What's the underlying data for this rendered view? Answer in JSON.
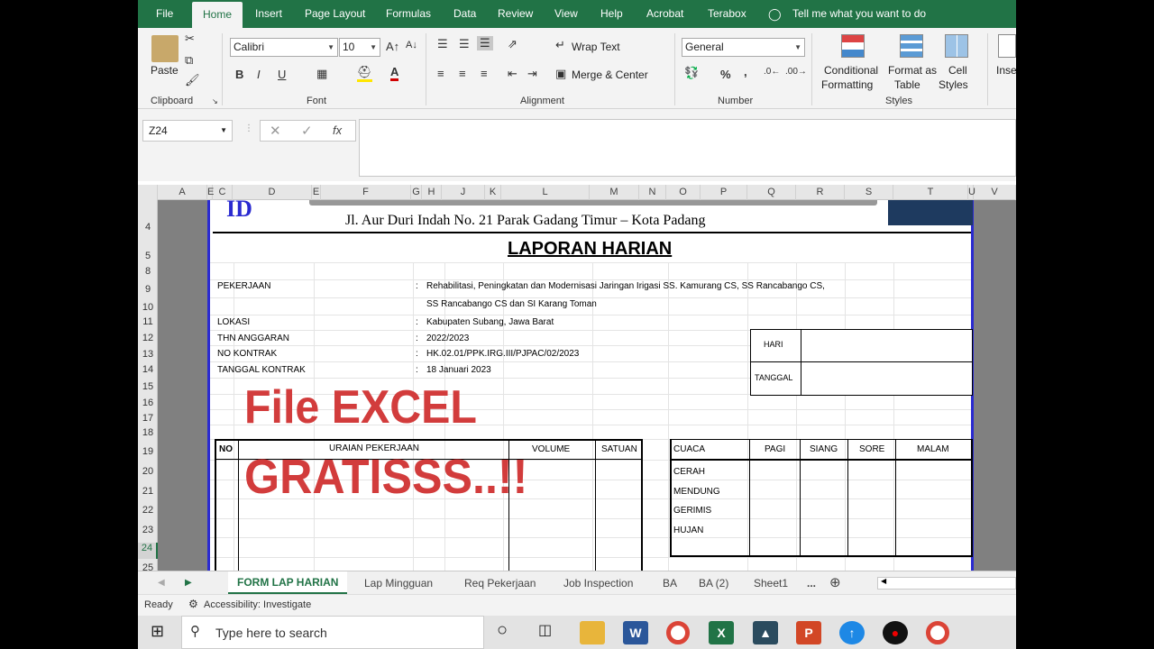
{
  "ribbon_tabs": [
    "File",
    "Home",
    "Insert",
    "Page Layout",
    "Formulas",
    "Data",
    "Review",
    "View",
    "Help",
    "Acrobat",
    "Terabox"
  ],
  "tell_me": "Tell me what you want to do",
  "clipboard": {
    "paste": "Paste",
    "label": "Clipboard"
  },
  "font": {
    "name": "Calibri",
    "size": "10",
    "label": "Font",
    "bold": "B",
    "italic": "I",
    "underline": "U"
  },
  "alignment": {
    "wrap": "Wrap Text",
    "merge": "Merge & Center",
    "label": "Alignment"
  },
  "number": {
    "format": "General",
    "label": "Number",
    "percent": "%",
    "comma": ","
  },
  "styles": {
    "conditional_1": "Conditional",
    "conditional_2": "Formatting",
    "format_1": "Format as",
    "format_2": "Table",
    "cell_1": "Cell",
    "cell_2": "Styles",
    "label": "Styles"
  },
  "insert_cut": "Inse",
  "formula_bar": {
    "name_box": "Z24",
    "fx": "fx",
    "value": ""
  },
  "columns": [
    "A",
    "E",
    "C",
    "D",
    "E",
    "F",
    "G",
    "H",
    "J",
    "K",
    "L",
    "M",
    "N",
    "O",
    "P",
    "Q",
    "R",
    "S",
    "T",
    "U",
    "V"
  ],
  "rows": [
    "4",
    "5",
    "8",
    "9",
    "10",
    "11",
    "12",
    "13",
    "14",
    "15",
    "16",
    "17",
    "18",
    "19",
    "20",
    "21",
    "22",
    "23",
    "24",
    "25"
  ],
  "doc": {
    "address": "Jl. Aur Duri Indah No. 21 Parak Gadang Timur – Kota Padang",
    "title": "LAPORAN HARIAN",
    "pekerjaan_label": "PEKERJAAN",
    "pekerjaan_1": "Rehabilitasi, Peningkatan dan Modernisasi Jaringan Irigasi SS. Kamurang CS, SS Rancabango CS,",
    "pekerjaan_2": "SS Rancabango CS dan SI Karang Toman",
    "lokasi_label": "LOKASI",
    "lokasi": "Kabupaten Subang, Jawa Barat",
    "thn_label": "THN ANGGARAN",
    "thn": "2022/2023",
    "kontrak_label": "NO KONTRAK",
    "kontrak": "HK.02.01/PPK.IRG.III/PJPAC/02/2023",
    "tgl_label": "TANGGAL KONTRAK",
    "tgl": "18 Januari 2023",
    "colon": ":",
    "hari": "HARI",
    "tanggal": "TANGGAL",
    "work_headers": [
      "NO",
      "URAIAN PEKERJAAN",
      "VOLUME",
      "SATUAN"
    ],
    "weather_headers": [
      "CUACA",
      "PAGI",
      "SIANG",
      "SORE",
      "MALAM"
    ],
    "weather_rows": [
      "CERAH",
      "MENDUNG",
      "GERIMIS",
      "HUJAN"
    ]
  },
  "overlay": {
    "line1": "File EXCEL",
    "line2": "GRATISSS..!!"
  },
  "sheet_tabs": [
    "FORM LAP HARIAN",
    "Lap Mingguan",
    "Req Pekerjaan",
    "Job Inspection",
    "BA",
    "BA (2)",
    "Sheet1",
    "..."
  ],
  "status": {
    "ready": "Ready",
    "accessibility": "Accessibility: Investigate"
  },
  "taskbar": {
    "search_placeholder": "Type here to search"
  },
  "colors": {
    "excel_green": "#217346",
    "overlay_red": "#d23c3c",
    "page_border": "#2a2ad0"
  }
}
